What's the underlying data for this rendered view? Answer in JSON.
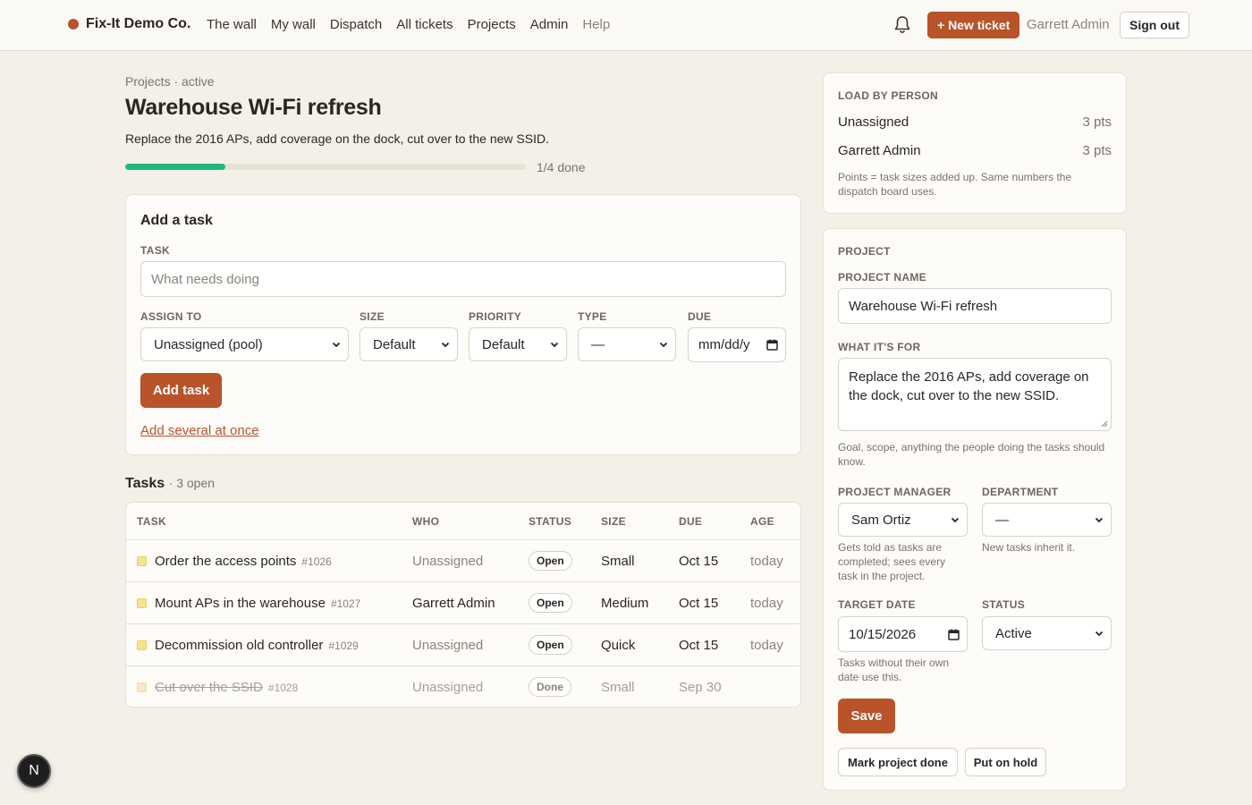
{
  "nav": {
    "brand": "Fix-It Demo Co.",
    "links": [
      "The wall",
      "My wall",
      "Dispatch",
      "All tickets",
      "Projects",
      "Admin",
      "Help"
    ],
    "new_ticket": "+ New ticket",
    "user": "Garrett Admin",
    "sign_out": "Sign out"
  },
  "header": {
    "breadcrumb": "Projects · active",
    "title": "Warehouse Wi-Fi refresh",
    "description": "Replace the 2016 APs, add coverage on the dock, cut over to the new SSID.",
    "progress_fraction": 0.25,
    "progress_label": "1/4 done"
  },
  "add_task": {
    "heading": "Add a task",
    "task_label": "TASK",
    "task_placeholder": "What needs doing",
    "assign_label": "ASSIGN TO",
    "assign_value": "Unassigned (pool)",
    "size_label": "SIZE",
    "size_value": "Default",
    "priority_label": "PRIORITY",
    "priority_value": "Default",
    "type_label": "TYPE",
    "type_value": "—",
    "due_label": "DUE",
    "due_value": "mm/dd/y",
    "submit": "Add task",
    "several": "Add several at once"
  },
  "tasks": {
    "heading": "Tasks",
    "count": "· 3 open",
    "columns": [
      "TASK",
      "WHO",
      "STATUS",
      "SIZE",
      "DUE",
      "AGE"
    ],
    "rows": [
      {
        "name": "Order the access points",
        "id": "#1026",
        "who": "Unassigned",
        "status": "Open",
        "size": "Small",
        "due": "Oct 15",
        "age": "today"
      },
      {
        "name": "Mount APs in the warehouse",
        "id": "#1027",
        "who": "Garrett Admin",
        "status": "Open",
        "size": "Medium",
        "due": "Oct 15",
        "age": "today"
      },
      {
        "name": "Decommission old controller",
        "id": "#1029",
        "who": "Unassigned",
        "status": "Open",
        "size": "Quick",
        "due": "Oct 15",
        "age": "today"
      },
      {
        "name": "Cut over the SSID",
        "id": "#1028",
        "who": "Unassigned",
        "status": "Done",
        "size": "Small",
        "due": "Sep 30",
        "age": ""
      }
    ]
  },
  "load": {
    "heading": "LOAD BY PERSON",
    "people": [
      {
        "name": "Unassigned",
        "pts": "3 pts"
      },
      {
        "name": "Garrett Admin",
        "pts": "3 pts"
      }
    ],
    "note": "Points = task sizes added up. Same numbers the dispatch board uses."
  },
  "project": {
    "heading": "PROJECT",
    "name_label": "PROJECT NAME",
    "name_value": "Warehouse Wi-Fi refresh",
    "for_label": "WHAT IT'S FOR",
    "for_value": "Replace the 2016 APs, add coverage on the dock, cut over to the new SSID.",
    "for_hint": "Goal, scope, anything the people doing the tasks should know.",
    "pm_label": "PROJECT MANAGER",
    "pm_value": "Sam Ortiz",
    "pm_hint": "Gets told as tasks are completed; sees every task in the project.",
    "dept_label": "DEPARTMENT",
    "dept_value": "—",
    "dept_hint": "New tasks inherit it.",
    "target_label": "TARGET DATE",
    "target_value": "10/15/2026",
    "target_hint": "Tasks without their own date use this.",
    "status_label": "STATUS",
    "status_value": "Active",
    "save": "Save",
    "mark_done": "Mark project done",
    "hold": "Put on hold"
  },
  "dev_badge": "N"
}
